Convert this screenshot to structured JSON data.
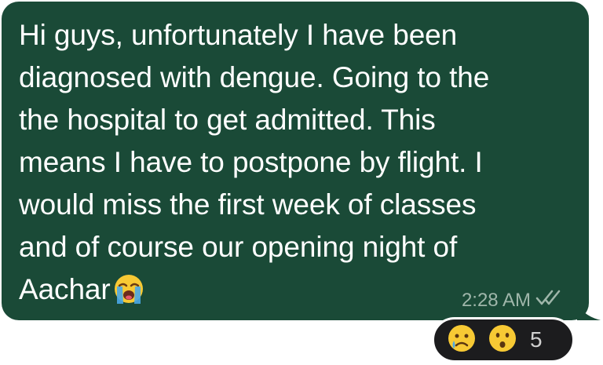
{
  "message": {
    "lines": [
      "Hi guys, unfortunately I have been",
      "diagnosed with dengue. Going to the",
      "the hospital to get admitted. This",
      "means I have to postpone by flight. I",
      "would miss the first week of classes",
      "and of course our opening night of",
      "Aachar"
    ],
    "trailing_emoji": "loudly-crying-face",
    "time": "2:28 AM",
    "status_icon": "double-check-icon"
  },
  "reactions": {
    "items": [
      "crying-face",
      "hushed-face"
    ],
    "count": "5"
  },
  "colors": {
    "bubble": "#1a4a37",
    "text": "#ffffff",
    "meta": "#9fb6aa",
    "reaction_pill": "#1c1c1e"
  }
}
